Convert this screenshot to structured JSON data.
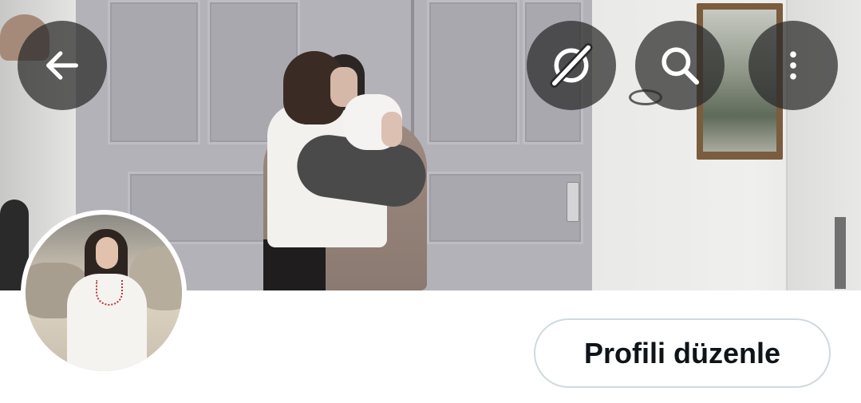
{
  "header": {
    "back_icon": "arrow-left-icon",
    "grok_icon": "grok-icon",
    "search_icon": "search-icon",
    "more_icon": "more-vertical-icon",
    "button_bg": "#282828"
  },
  "banner": {
    "kind": "profile-header-photo"
  },
  "profile": {
    "avatar_kind": "profile-picture"
  },
  "actions": {
    "edit_profile_label": "Profili düzenle",
    "border_color": "#cfd9de",
    "text_color": "#0f1419"
  }
}
